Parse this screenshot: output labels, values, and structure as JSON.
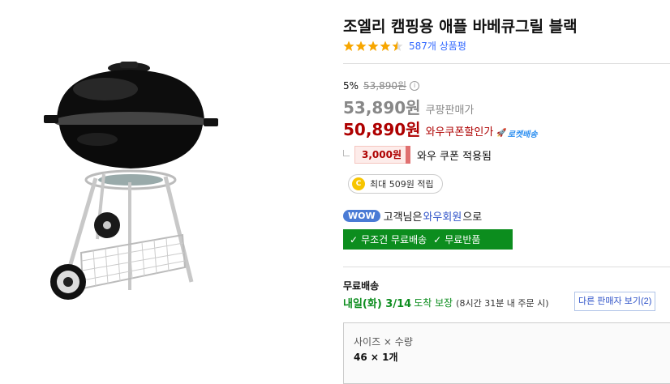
{
  "product": {
    "title": "조엘리 캠핑용 애플 바베큐그릴 블랙",
    "rating": 4.5,
    "review_count": "587개 상품평"
  },
  "price": {
    "discount_rate": "5%",
    "original_price": "53,890원",
    "info_icon": "i",
    "sale_price": "53,890원",
    "sale_label": "쿠팡판매가",
    "coupon_price": "50,890원",
    "coupon_label": "와우쿠폰할인가",
    "rocket_label": "로켓배송",
    "coupon_amount": "3,000원",
    "coupon_applied": "와우 쿠폰 적용됨"
  },
  "cash": {
    "icon": "C",
    "text": "최대 509원 적립"
  },
  "wow": {
    "badge": "WOW",
    "text_before": "고객님은",
    "link": "와우회원",
    "text_after": "으로",
    "benefit1": "무조건 무료배송",
    "benefit2": "무료반품",
    "check_icon": "✓"
  },
  "shipping": {
    "label": "무료배송",
    "delivery_date": "내일(화) 3/14",
    "guarantee": "도착 보장",
    "note": "(8시간 31분 내 주문 시)",
    "other_sellers": "다른 판매자 보기(2)"
  },
  "option": {
    "label": "사이즈 × 수량",
    "value": "46 × 1개"
  },
  "colors": {
    "price_red": "#ae0000",
    "rocket_blue": "#2d8ff0",
    "wow_green": "#0c8d1e",
    "link_blue": "#346aff",
    "star": "#f7a600"
  },
  "icons": {
    "star": "star-icon",
    "rocket": "rocket-icon",
    "check": "check-icon",
    "cash": "coin-icon"
  }
}
